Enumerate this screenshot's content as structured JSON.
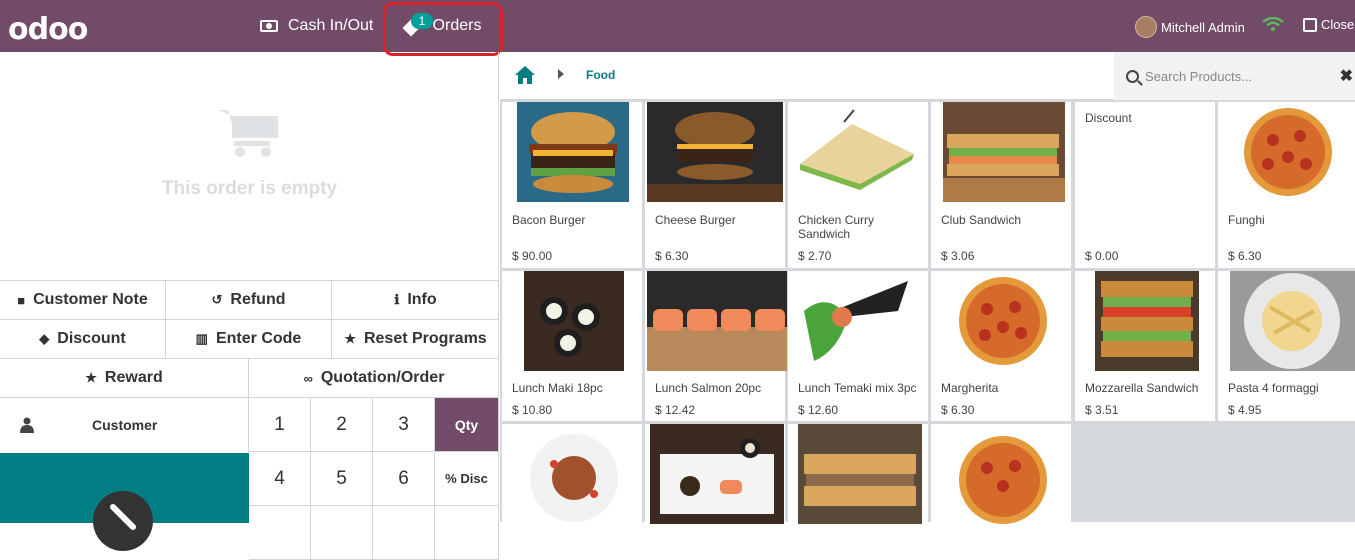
{
  "topbar": {
    "logo": "odoo",
    "cash_label": "Cash In/Out",
    "orders_label": "Orders",
    "orders_badge": "1",
    "user_name": "Mitchell Admin",
    "close_label": "Close"
  },
  "order": {
    "empty_text": "This order is empty"
  },
  "controls": {
    "row1": [
      "Customer Note",
      "Refund",
      "Info"
    ],
    "row2": [
      "Discount",
      "Enter Code",
      "Reset Programs"
    ],
    "row3": [
      "Reward",
      "Quotation/Order"
    ]
  },
  "numpad": {
    "customer": "Customer",
    "keys": [
      "1",
      "2",
      "3",
      "4",
      "5",
      "6"
    ],
    "qty": "Qty",
    "disc": "% Disc"
  },
  "breadcrumb": {
    "category": "Food"
  },
  "search": {
    "placeholder": "Search Products..."
  },
  "products": [
    {
      "name": "Bacon Burger",
      "price": "$ 90.00"
    },
    {
      "name": "Cheese Burger",
      "price": "$ 6.30"
    },
    {
      "name": "Chicken Curry Sandwich",
      "price": "$ 2.70"
    },
    {
      "name": "Club Sandwich",
      "price": "$ 3.06"
    },
    {
      "name": "Discount",
      "price": "$ 0.00"
    },
    {
      "name": "Funghi",
      "price": "$ 6.30"
    },
    {
      "name": "Lunch Maki 18pc",
      "price": "$ 10.80"
    },
    {
      "name": "Lunch Salmon 20pc",
      "price": "$ 12.42"
    },
    {
      "name": "Lunch Temaki mix 3pc",
      "price": "$ 12.60"
    },
    {
      "name": "Margherita",
      "price": "$ 6.30"
    },
    {
      "name": "Mozzarella Sandwich",
      "price": "$ 3.51"
    },
    {
      "name": "Pasta 4 formaggi",
      "price": "$ 4.95"
    }
  ],
  "colors": {
    "brand": "#714b67",
    "accent": "#017e84",
    "badge": "#00a09d",
    "highlight": "#d8232a"
  }
}
